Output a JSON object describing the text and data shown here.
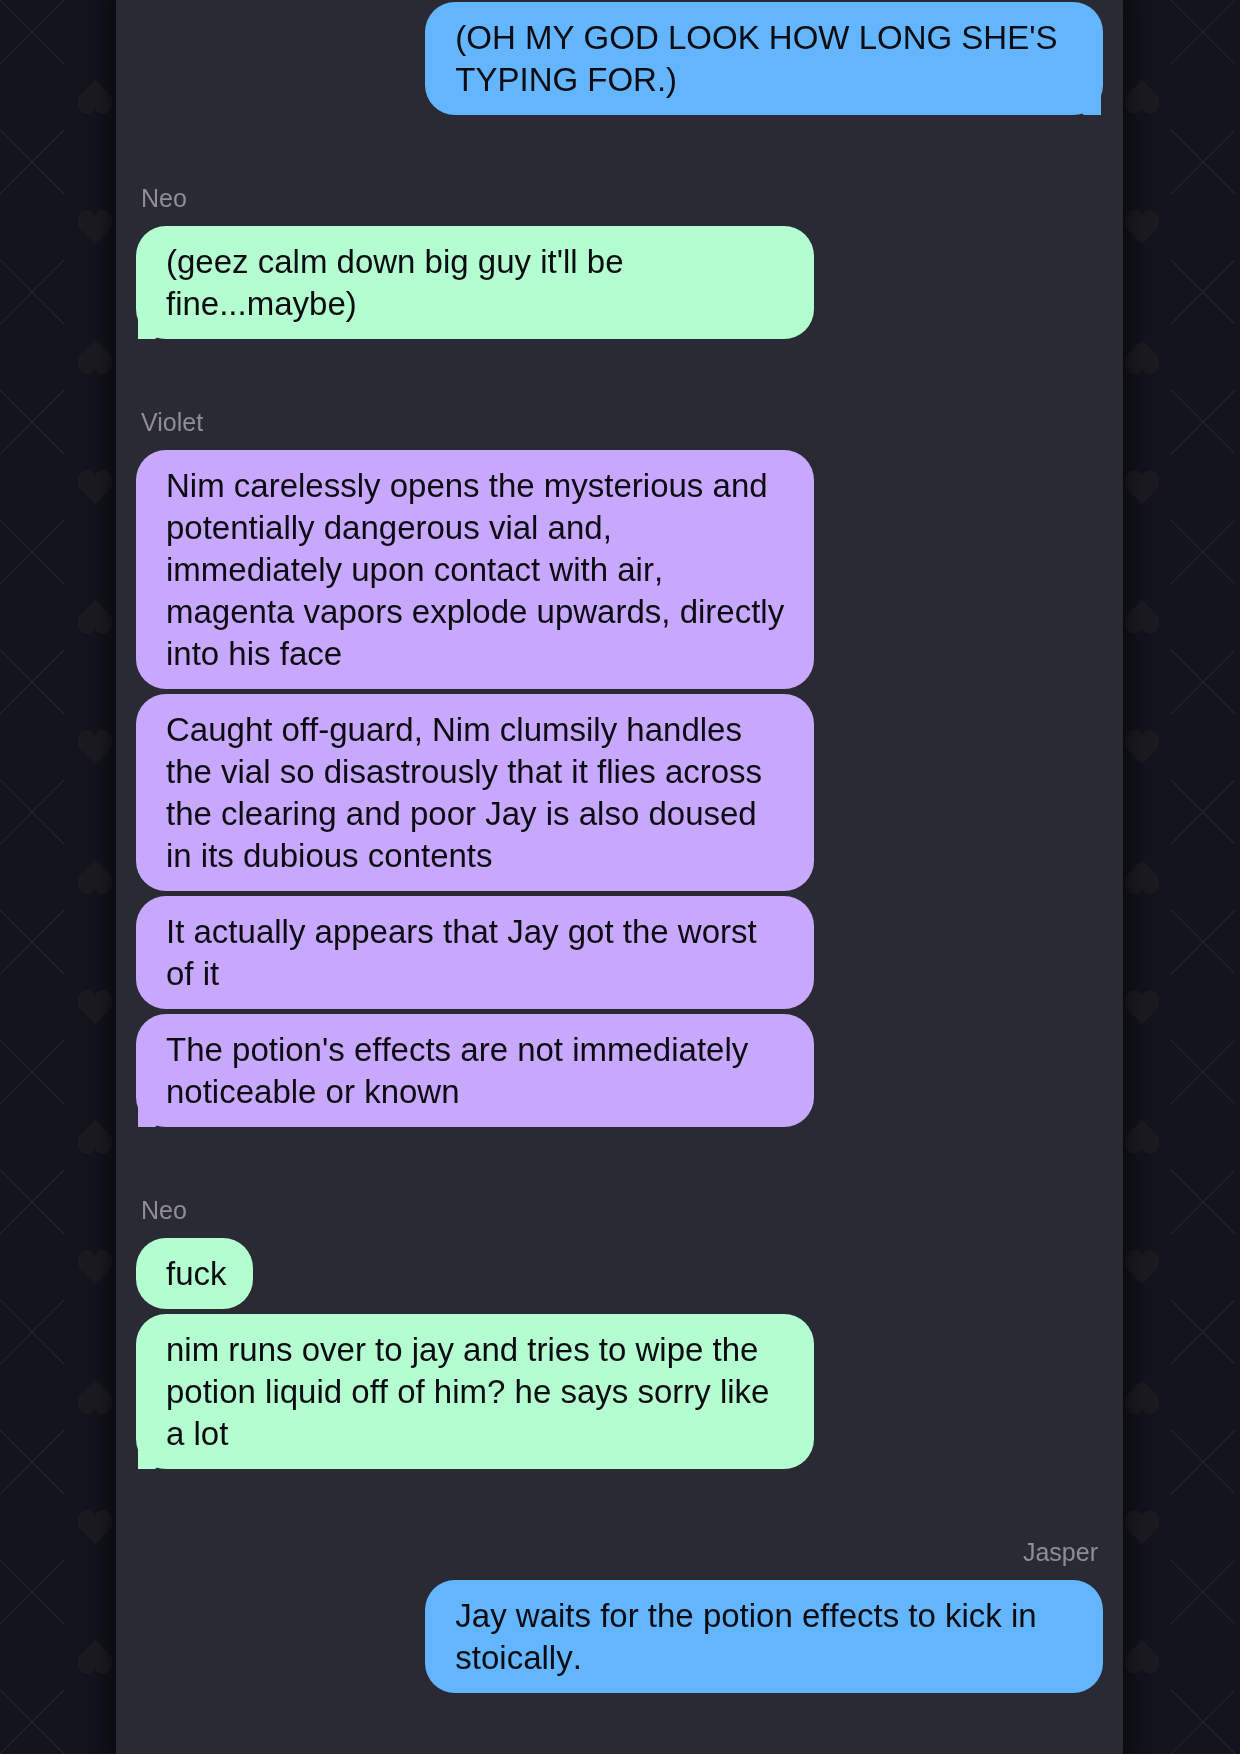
{
  "chat": {
    "groups": [
      {
        "kind": "sent",
        "color": "#63b5fe",
        "messages": [
          {
            "text": "(OH MY GOD LOOK HOW LONG SHE'S TYPING FOR.)",
            "tail": true
          }
        ]
      },
      {
        "kind": "received",
        "sender": "Neo",
        "color": "#b3fdd0",
        "messages": [
          {
            "text": "(geez calm down big guy it'll be fine...maybe)",
            "tail": true
          }
        ]
      },
      {
        "kind": "received",
        "sender": "Violet",
        "color": "#c7a8fd",
        "messages": [
          {
            "text": "Nim carelessly opens the mysterious and potentially dangerous vial and, immediately upon contact with air, magenta vapors explode upwards, directly into his face",
            "tail": false
          },
          {
            "text": "Caught off-guard, Nim clumsily handles the vial so disastrously that it flies across the clearing and poor Jay is also doused in its dubious contents",
            "tail": false
          },
          {
            "text": "It actually appears that Jay got the worst of it",
            "tail": false
          },
          {
            "text": "The potion's effects are not immediately noticeable or known",
            "tail": true
          }
        ]
      },
      {
        "kind": "received",
        "sender": "Neo",
        "color": "#b3fdd0",
        "messages": [
          {
            "text": "fuck",
            "tail": false
          },
          {
            "text": "nim runs over to jay and tries to wipe the potion liquid off of him? he says sorry like a lot",
            "tail": true
          }
        ]
      },
      {
        "kind": "sent",
        "sender": "Jasper",
        "color": "#63b5fe",
        "messages": [
          {
            "text": "Jay waits for the potion effects to kick in stoically.",
            "tail": false
          }
        ]
      }
    ]
  }
}
